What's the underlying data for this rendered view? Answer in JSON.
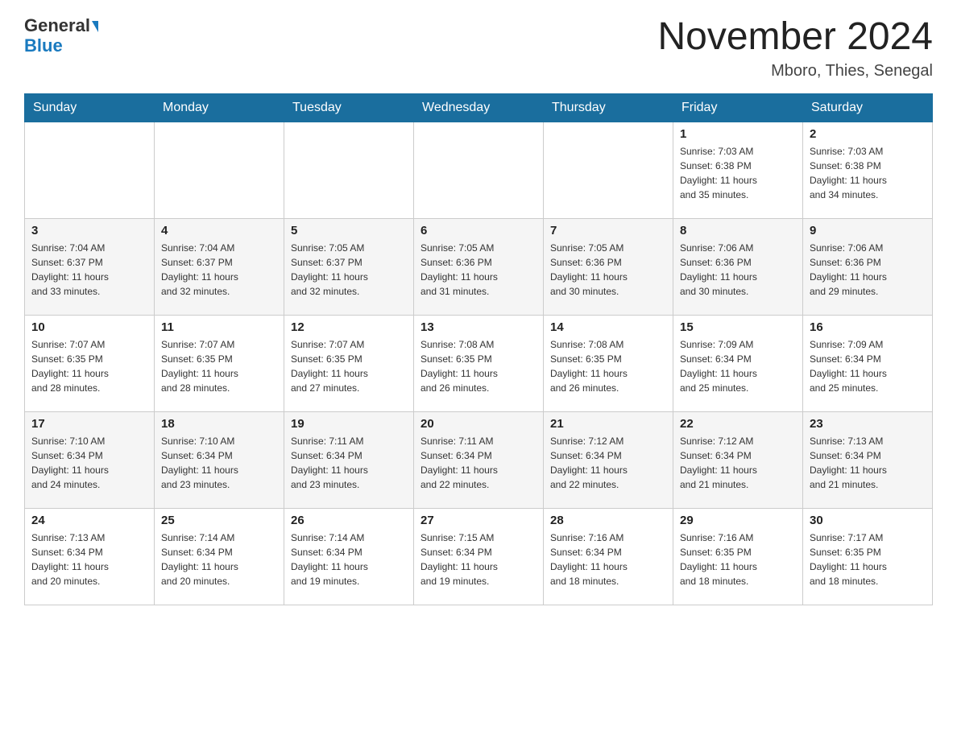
{
  "header": {
    "logo_line1": "General",
    "logo_line2": "Blue",
    "title": "November 2024",
    "subtitle": "Mboro, Thies, Senegal"
  },
  "days_of_week": [
    "Sunday",
    "Monday",
    "Tuesday",
    "Wednesday",
    "Thursday",
    "Friday",
    "Saturday"
  ],
  "weeks": [
    {
      "days": [
        {
          "num": "",
          "info": ""
        },
        {
          "num": "",
          "info": ""
        },
        {
          "num": "",
          "info": ""
        },
        {
          "num": "",
          "info": ""
        },
        {
          "num": "",
          "info": ""
        },
        {
          "num": "1",
          "info": "Sunrise: 7:03 AM\nSunset: 6:38 PM\nDaylight: 11 hours\nand 35 minutes."
        },
        {
          "num": "2",
          "info": "Sunrise: 7:03 AM\nSunset: 6:38 PM\nDaylight: 11 hours\nand 34 minutes."
        }
      ]
    },
    {
      "days": [
        {
          "num": "3",
          "info": "Sunrise: 7:04 AM\nSunset: 6:37 PM\nDaylight: 11 hours\nand 33 minutes."
        },
        {
          "num": "4",
          "info": "Sunrise: 7:04 AM\nSunset: 6:37 PM\nDaylight: 11 hours\nand 32 minutes."
        },
        {
          "num": "5",
          "info": "Sunrise: 7:05 AM\nSunset: 6:37 PM\nDaylight: 11 hours\nand 32 minutes."
        },
        {
          "num": "6",
          "info": "Sunrise: 7:05 AM\nSunset: 6:36 PM\nDaylight: 11 hours\nand 31 minutes."
        },
        {
          "num": "7",
          "info": "Sunrise: 7:05 AM\nSunset: 6:36 PM\nDaylight: 11 hours\nand 30 minutes."
        },
        {
          "num": "8",
          "info": "Sunrise: 7:06 AM\nSunset: 6:36 PM\nDaylight: 11 hours\nand 30 minutes."
        },
        {
          "num": "9",
          "info": "Sunrise: 7:06 AM\nSunset: 6:36 PM\nDaylight: 11 hours\nand 29 minutes."
        }
      ]
    },
    {
      "days": [
        {
          "num": "10",
          "info": "Sunrise: 7:07 AM\nSunset: 6:35 PM\nDaylight: 11 hours\nand 28 minutes."
        },
        {
          "num": "11",
          "info": "Sunrise: 7:07 AM\nSunset: 6:35 PM\nDaylight: 11 hours\nand 28 minutes."
        },
        {
          "num": "12",
          "info": "Sunrise: 7:07 AM\nSunset: 6:35 PM\nDaylight: 11 hours\nand 27 minutes."
        },
        {
          "num": "13",
          "info": "Sunrise: 7:08 AM\nSunset: 6:35 PM\nDaylight: 11 hours\nand 26 minutes."
        },
        {
          "num": "14",
          "info": "Sunrise: 7:08 AM\nSunset: 6:35 PM\nDaylight: 11 hours\nand 26 minutes."
        },
        {
          "num": "15",
          "info": "Sunrise: 7:09 AM\nSunset: 6:34 PM\nDaylight: 11 hours\nand 25 minutes."
        },
        {
          "num": "16",
          "info": "Sunrise: 7:09 AM\nSunset: 6:34 PM\nDaylight: 11 hours\nand 25 minutes."
        }
      ]
    },
    {
      "days": [
        {
          "num": "17",
          "info": "Sunrise: 7:10 AM\nSunset: 6:34 PM\nDaylight: 11 hours\nand 24 minutes."
        },
        {
          "num": "18",
          "info": "Sunrise: 7:10 AM\nSunset: 6:34 PM\nDaylight: 11 hours\nand 23 minutes."
        },
        {
          "num": "19",
          "info": "Sunrise: 7:11 AM\nSunset: 6:34 PM\nDaylight: 11 hours\nand 23 minutes."
        },
        {
          "num": "20",
          "info": "Sunrise: 7:11 AM\nSunset: 6:34 PM\nDaylight: 11 hours\nand 22 minutes."
        },
        {
          "num": "21",
          "info": "Sunrise: 7:12 AM\nSunset: 6:34 PM\nDaylight: 11 hours\nand 22 minutes."
        },
        {
          "num": "22",
          "info": "Sunrise: 7:12 AM\nSunset: 6:34 PM\nDaylight: 11 hours\nand 21 minutes."
        },
        {
          "num": "23",
          "info": "Sunrise: 7:13 AM\nSunset: 6:34 PM\nDaylight: 11 hours\nand 21 minutes."
        }
      ]
    },
    {
      "days": [
        {
          "num": "24",
          "info": "Sunrise: 7:13 AM\nSunset: 6:34 PM\nDaylight: 11 hours\nand 20 minutes."
        },
        {
          "num": "25",
          "info": "Sunrise: 7:14 AM\nSunset: 6:34 PM\nDaylight: 11 hours\nand 20 minutes."
        },
        {
          "num": "26",
          "info": "Sunrise: 7:14 AM\nSunset: 6:34 PM\nDaylight: 11 hours\nand 19 minutes."
        },
        {
          "num": "27",
          "info": "Sunrise: 7:15 AM\nSunset: 6:34 PM\nDaylight: 11 hours\nand 19 minutes."
        },
        {
          "num": "28",
          "info": "Sunrise: 7:16 AM\nSunset: 6:34 PM\nDaylight: 11 hours\nand 18 minutes."
        },
        {
          "num": "29",
          "info": "Sunrise: 7:16 AM\nSunset: 6:35 PM\nDaylight: 11 hours\nand 18 minutes."
        },
        {
          "num": "30",
          "info": "Sunrise: 7:17 AM\nSunset: 6:35 PM\nDaylight: 11 hours\nand 18 minutes."
        }
      ]
    }
  ]
}
